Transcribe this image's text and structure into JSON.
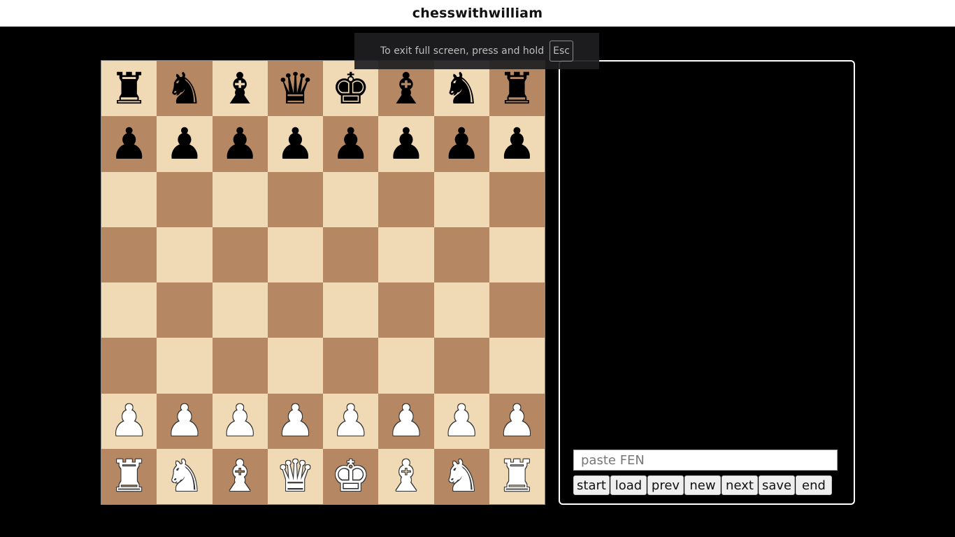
{
  "header": {
    "title": "chesswithwilliam"
  },
  "fullscreen_notice": {
    "text": "To exit full screen, press and hold",
    "key": "Esc"
  },
  "board": {
    "light_color": "#f0d9b5",
    "dark_color": "#b58863",
    "rows": [
      [
        {
          "glyph": "♜",
          "color": "black",
          "icon": "black-rook-icon"
        },
        {
          "glyph": "♞",
          "color": "black",
          "icon": "black-knight-icon"
        },
        {
          "glyph": "♝",
          "color": "black",
          "icon": "black-bishop-icon"
        },
        {
          "glyph": "♛",
          "color": "black",
          "icon": "black-queen-icon"
        },
        {
          "glyph": "♚",
          "color": "black",
          "icon": "black-king-icon"
        },
        {
          "glyph": "♝",
          "color": "black",
          "icon": "black-bishop-icon"
        },
        {
          "glyph": "♞",
          "color": "black",
          "icon": "black-knight-icon"
        },
        {
          "glyph": "♜",
          "color": "black",
          "icon": "black-rook-icon"
        }
      ],
      [
        {
          "glyph": "♟",
          "color": "black",
          "icon": "black-pawn-icon"
        },
        {
          "glyph": "♟",
          "color": "black",
          "icon": "black-pawn-icon"
        },
        {
          "glyph": "♟",
          "color": "black",
          "icon": "black-pawn-icon"
        },
        {
          "glyph": "♟",
          "color": "black",
          "icon": "black-pawn-icon"
        },
        {
          "glyph": "♟",
          "color": "black",
          "icon": "black-pawn-icon"
        },
        {
          "glyph": "♟",
          "color": "black",
          "icon": "black-pawn-icon"
        },
        {
          "glyph": "♟",
          "color": "black",
          "icon": "black-pawn-icon"
        },
        {
          "glyph": "♟",
          "color": "black",
          "icon": "black-pawn-icon"
        }
      ],
      [
        null,
        null,
        null,
        null,
        null,
        null,
        null,
        null
      ],
      [
        null,
        null,
        null,
        null,
        null,
        null,
        null,
        null
      ],
      [
        null,
        null,
        null,
        null,
        null,
        null,
        null,
        null
      ],
      [
        null,
        null,
        null,
        null,
        null,
        null,
        null,
        null
      ],
      [
        {
          "glyph": "♟",
          "color": "white",
          "icon": "white-pawn-icon"
        },
        {
          "glyph": "♟",
          "color": "white",
          "icon": "white-pawn-icon"
        },
        {
          "glyph": "♟",
          "color": "white",
          "icon": "white-pawn-icon"
        },
        {
          "glyph": "♟",
          "color": "white",
          "icon": "white-pawn-icon"
        },
        {
          "glyph": "♟",
          "color": "white",
          "icon": "white-pawn-icon"
        },
        {
          "glyph": "♟",
          "color": "white",
          "icon": "white-pawn-icon"
        },
        {
          "glyph": "♟",
          "color": "white",
          "icon": "white-pawn-icon"
        },
        {
          "glyph": "♟",
          "color": "white",
          "icon": "white-pawn-icon"
        }
      ],
      [
        {
          "glyph": "♜",
          "color": "white",
          "icon": "white-rook-icon"
        },
        {
          "glyph": "♞",
          "color": "white",
          "icon": "white-knight-icon"
        },
        {
          "glyph": "♝",
          "color": "white",
          "icon": "white-bishop-icon"
        },
        {
          "glyph": "♛",
          "color": "white",
          "icon": "white-queen-icon"
        },
        {
          "glyph": "♚",
          "color": "white",
          "icon": "white-king-icon"
        },
        {
          "glyph": "♝",
          "color": "white",
          "icon": "white-bishop-icon"
        },
        {
          "glyph": "♞",
          "color": "white",
          "icon": "white-knight-icon"
        },
        {
          "glyph": "♜",
          "color": "white",
          "icon": "white-rook-icon"
        }
      ]
    ]
  },
  "panel": {
    "fen_input": {
      "placeholder": "paste FEN",
      "value": ""
    },
    "buttons": {
      "start": "start",
      "load": "load",
      "prev": "prev",
      "new": "new",
      "next": "next",
      "save": "save",
      "end": "end"
    }
  }
}
